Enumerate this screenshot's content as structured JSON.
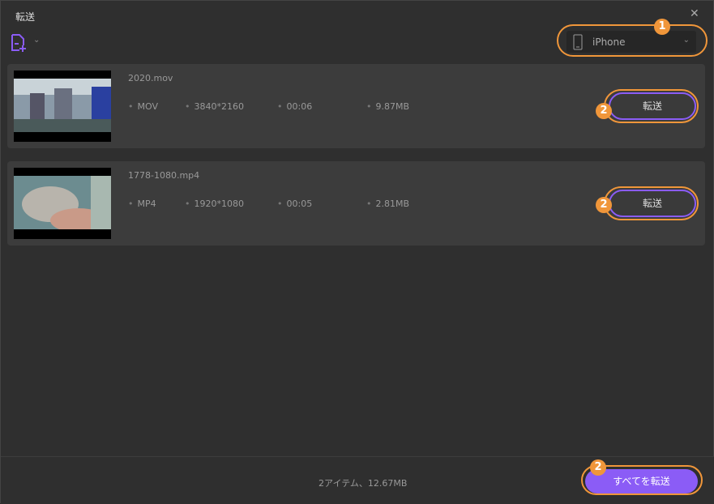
{
  "window": {
    "title": "転送",
    "close_icon": "close-icon"
  },
  "toolbar": {
    "add_file_icon": "add-file-icon",
    "dropdown_icon": "chevron-down-icon"
  },
  "device": {
    "icon": "phone-icon",
    "name": "iPhone"
  },
  "items": [
    {
      "filename": "2020.mov",
      "format": "MOV",
      "resolution": "3840*2160",
      "duration": "00:06",
      "size": "9.87MB",
      "button": "転送"
    },
    {
      "filename": "1778-1080.mp4",
      "format": "MP4",
      "resolution": "1920*1080",
      "duration": "00:05",
      "size": "2.81MB",
      "button": "転送"
    }
  ],
  "footer": {
    "summary": "2アイテム、12.67MB",
    "transfer_all": "すべてを転送"
  },
  "annotations": {
    "step1": "1",
    "step2": "2"
  },
  "colors": {
    "accent": "#8b5cf6",
    "annotation": "#f0963a"
  }
}
